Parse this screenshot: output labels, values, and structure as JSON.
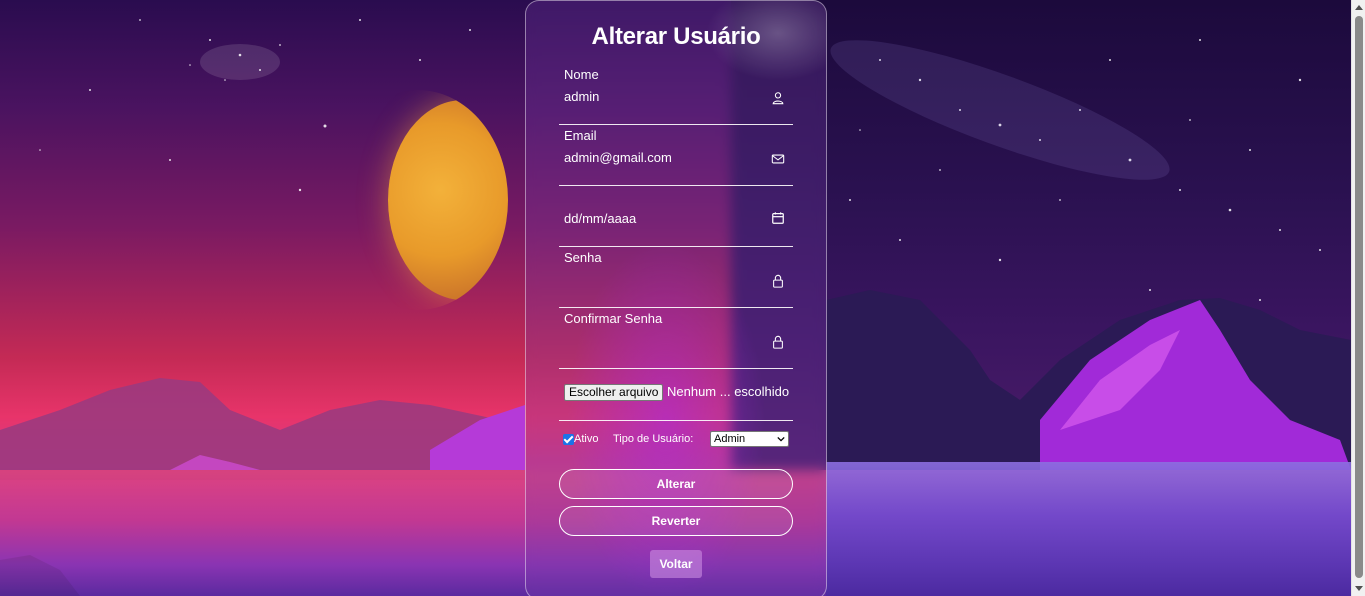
{
  "form": {
    "title": "Alterar Usuário",
    "nome": {
      "label": "Nome",
      "value": "admin",
      "icon": "user-icon"
    },
    "email": {
      "label": "Email",
      "value": "admin@gmail.com",
      "icon": "mail-icon"
    },
    "data": {
      "placeholder": "dd/mm/aaaa",
      "icon": "calendar-icon"
    },
    "senha": {
      "label": "Senha",
      "value": "",
      "icon": "lock-icon"
    },
    "confirmar": {
      "label": "Confirmar Senha",
      "value": "",
      "icon": "lock-icon"
    },
    "arquivo": {
      "button_label": "Escolher arquivo",
      "status": "Nenhum ... escolhido"
    },
    "ativo": {
      "label": "Ativo",
      "checked": true
    },
    "tipo": {
      "label": "Tipo de Usuário:",
      "selected": "Admin"
    },
    "buttons": {
      "alterar": "Alterar",
      "reverter": "Reverter",
      "voltar": "Voltar"
    }
  },
  "colors": {
    "accent_checkbox": "#1a73e8",
    "card_border": "#ffffff",
    "text": "#ffffff"
  }
}
